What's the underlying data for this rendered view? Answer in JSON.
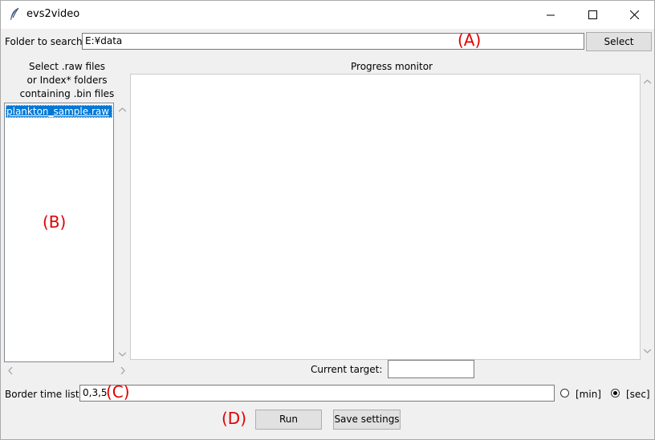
{
  "window": {
    "title": "evs2video"
  },
  "folder": {
    "label": "Folder to search",
    "value": "E:¥data",
    "select_label": "Select"
  },
  "files": {
    "label_line1": "Select .raw files",
    "label_line2": "or Index* folders",
    "label_line3": "containing .bin files",
    "items": [
      "plankton_sample.raw"
    ]
  },
  "progress": {
    "label": "Progress monitor"
  },
  "current_target": {
    "label": "Current target:",
    "value": ""
  },
  "border": {
    "label": "Border time list",
    "value": "0,3,5"
  },
  "units": {
    "min_label": "[min]",
    "sec_label": "[sec]",
    "selected": "sec"
  },
  "actions": {
    "run_label": "Run",
    "save_label": "Save settings"
  },
  "annotations": {
    "a": "(A)",
    "b": "(B)",
    "c": "(C)",
    "d": "(D)"
  },
  "colors": {
    "annotation": "#e00000",
    "selection": "#0078d7"
  }
}
